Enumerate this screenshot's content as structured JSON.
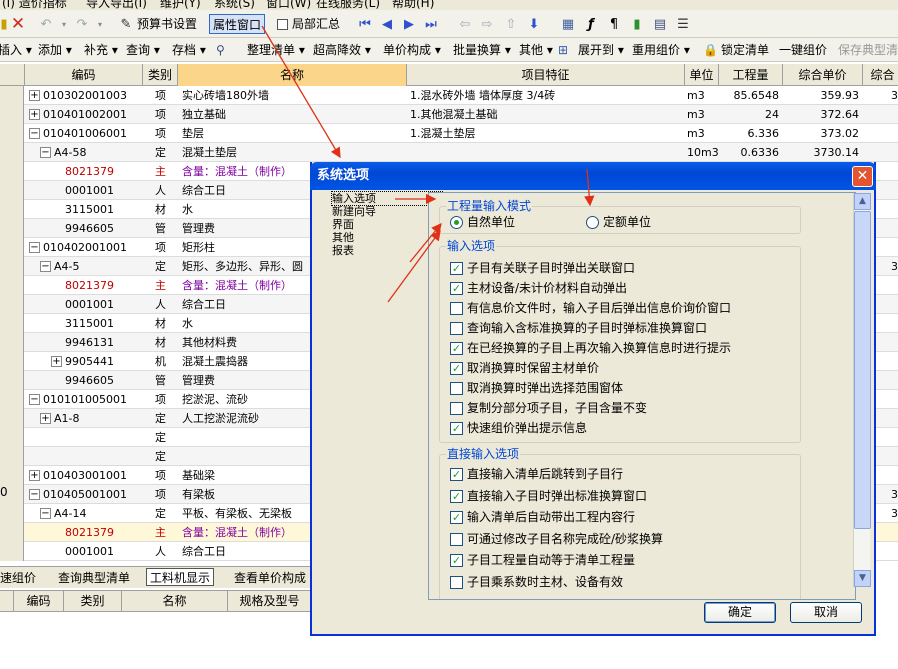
{
  "menu": [
    "(I)  造价指标",
    "导入导出(I)",
    "维护(Y)",
    "系统(S)",
    "窗口(W)",
    "在线服务(L)",
    "帮助(H)"
  ],
  "toolbar1": {
    "budget_settings": "预算书设置",
    "property_window": "属性窗口",
    "partial_summary": "局部汇总"
  },
  "toolbar2": {
    "insert": "插入",
    "add": "添加",
    "supplement": "补充",
    "query": "查询",
    "storage": "存档",
    "organize_list": "整理清单",
    "hyper_height": "超高降效",
    "unit_price_composition": "单价构成",
    "batch_convert": "批量换算",
    "other": "其他",
    "expand_to": "展开到",
    "reuse_composition": "重用组价",
    "lock_list": "锁定清单",
    "one_key_pricing": "一键组价",
    "save_typical": "保存典型清"
  },
  "grid": {
    "headers": [
      "编码",
      "类别",
      "名称",
      "项目特征",
      "单位",
      "工程量",
      "综合单价",
      "综合"
    ],
    "rows": [
      {
        "code": "010302001003",
        "cat": "项",
        "name": "实心砖墙180外墙",
        "feature": "1.混水砖外墙 墙体厚度 3/4砖",
        "unit": "m3",
        "qty": "85.6548",
        "price": "359.93",
        "extra": "3",
        "exp": "+",
        "indent": 1
      },
      {
        "code": "010401002001",
        "cat": "项",
        "name": "独立基础",
        "feature": "1.其他混凝土基础",
        "unit": "m3",
        "qty": "24",
        "price": "372.64",
        "extra": "",
        "exp": "+",
        "indent": 1
      },
      {
        "code": "010401006001",
        "cat": "项",
        "name": "垫层",
        "feature": "1.混凝土垫层",
        "unit": "m3",
        "qty": "6.336",
        "price": "373.02",
        "extra": "",
        "exp": "−",
        "indent": 1
      },
      {
        "code": "A4-58",
        "cat": "定",
        "name": "混凝土垫层",
        "feature": "",
        "unit": "10m3",
        "qty": "0.6336",
        "price": "3730.14",
        "extra": "",
        "exp": "−",
        "indent": 2
      },
      {
        "code": "8021379",
        "cat": "主",
        "name": "含量：混凝土（制作）",
        "feature": "",
        "unit": "",
        "qty": "",
        "price": "",
        "extra": "",
        "exp": "",
        "indent": 3,
        "red": true
      },
      {
        "code": "0001001",
        "cat": "人",
        "name": "综合工日",
        "feature": "",
        "unit": "",
        "qty": "",
        "price": "",
        "extra": "",
        "exp": "",
        "indent": 3
      },
      {
        "code": "3115001",
        "cat": "材",
        "name": "水",
        "feature": "",
        "unit": "",
        "qty": "",
        "price": "",
        "extra": "",
        "exp": "",
        "indent": 3
      },
      {
        "code": "9946605",
        "cat": "管",
        "name": "管理费",
        "feature": "",
        "unit": "",
        "qty": "",
        "price": "",
        "extra": "",
        "exp": "",
        "indent": 3
      },
      {
        "code": "010402001001",
        "cat": "项",
        "name": "矩形柱",
        "feature": "",
        "unit": "",
        "qty": "",
        "price": "",
        "extra": "",
        "exp": "−",
        "indent": 1
      },
      {
        "code": "A4-5",
        "cat": "定",
        "name": "矩形、多边形、异形、圆",
        "feature": "",
        "unit": "",
        "qty": "",
        "price": "",
        "extra": "3",
        "exp": "−",
        "indent": 2
      },
      {
        "code": "8021379",
        "cat": "主",
        "name": "含量：混凝土（制作）",
        "feature": "",
        "unit": "",
        "qty": "",
        "price": "",
        "extra": "",
        "exp": "",
        "indent": 3,
        "red": true
      },
      {
        "code": "0001001",
        "cat": "人",
        "name": "综合工日",
        "feature": "",
        "unit": "",
        "qty": "",
        "price": "",
        "extra": "",
        "exp": "",
        "indent": 3
      },
      {
        "code": "3115001",
        "cat": "材",
        "name": "水",
        "feature": "",
        "unit": "",
        "qty": "",
        "price": "",
        "extra": "",
        "exp": "",
        "indent": 3
      },
      {
        "code": "9946131",
        "cat": "材",
        "name": "其他材料费",
        "feature": "",
        "unit": "",
        "qty": "",
        "price": "",
        "extra": "",
        "exp": "",
        "indent": 3
      },
      {
        "code": "9905441",
        "cat": "机",
        "name": "混凝土震捣器",
        "feature": "",
        "unit": "",
        "qty": "",
        "price": "",
        "extra": "",
        "exp": "+",
        "indent": 3
      },
      {
        "code": "9946605",
        "cat": "管",
        "name": "管理费",
        "feature": "",
        "unit": "",
        "qty": "",
        "price": "",
        "extra": "",
        "exp": "",
        "indent": 3
      },
      {
        "code": "010101005001",
        "cat": "项",
        "name": "挖淤泥、流砂",
        "feature": "",
        "unit": "",
        "qty": "",
        "price": "",
        "extra": "",
        "exp": "−",
        "indent": 1
      },
      {
        "code": "A1-8",
        "cat": "定",
        "name": "人工挖淤泥流砂",
        "feature": "",
        "unit": "",
        "qty": "",
        "price": "",
        "extra": "",
        "exp": "+",
        "indent": 2
      },
      {
        "code": "",
        "cat": "定",
        "name": "",
        "feature": "",
        "unit": "",
        "qty": "",
        "price": "",
        "extra": "",
        "exp": "",
        "indent": 2
      },
      {
        "code": "",
        "cat": "定",
        "name": "",
        "feature": "",
        "unit": "",
        "qty": "",
        "price": "",
        "extra": "",
        "exp": "",
        "indent": 2
      },
      {
        "code": "010403001001",
        "cat": "项",
        "name": "基础梁",
        "feature": "",
        "unit": "",
        "qty": "",
        "price": "",
        "extra": "",
        "exp": "+",
        "indent": 1
      },
      {
        "code": "010405001001",
        "cat": "项",
        "name": "有梁板",
        "feature": "",
        "unit": "",
        "qty": "",
        "price": "",
        "extra": "3",
        "exp": "−",
        "indent": 1,
        "rownum": "0"
      },
      {
        "code": "A4-14",
        "cat": "定",
        "name": "平板、有梁板、无梁板",
        "feature": "",
        "unit": "",
        "qty": "",
        "price": "",
        "extra": "3",
        "exp": "−",
        "indent": 2
      },
      {
        "code": "8021379",
        "cat": "主",
        "name": "含量：混凝土（制作）",
        "feature": "",
        "unit": "",
        "qty": "",
        "price": "",
        "extra": "",
        "exp": "",
        "indent": 3,
        "red": true,
        "hl": true
      },
      {
        "code": "0001001",
        "cat": "人",
        "name": "综合工日",
        "feature": "",
        "unit": "",
        "qty": "",
        "price": "",
        "extra": "",
        "exp": "",
        "indent": 3
      }
    ]
  },
  "bottom_tabs": [
    "速组价",
    "查询典型清单",
    "工料机显示",
    "查看单价构成"
  ],
  "lower_headers": [
    "编码",
    "类别",
    "名称",
    "规格及型号"
  ],
  "dialog": {
    "title": "系统选项",
    "nav": [
      "输入选项",
      "新建向导",
      "界面",
      "其他",
      "报表"
    ],
    "mode_group": {
      "title": "工程量输入模式",
      "natural_unit": "自然单位",
      "quota_unit": "定额单位"
    },
    "input_group": {
      "title": "输入选项",
      "options": [
        {
          "label": "子目有关联子目时弹出关联窗口",
          "checked": true
        },
        {
          "label": "主材设备/未计价材料自动弹出",
          "checked": true
        },
        {
          "label": "有信息价文件时，输入子目后弹出信息价询价窗口",
          "checked": false
        },
        {
          "label": "查询输入含标准换算的子目时弹标准换算窗口",
          "checked": false
        },
        {
          "label": "在已经换算的子目上再次输入换算信息时进行提示",
          "checked": true
        },
        {
          "label": "取消换算时保留主材单价",
          "checked": true
        },
        {
          "label": "取消换算时弹出选择范围窗体",
          "checked": false
        },
        {
          "label": "复制分部分项子目，子目含量不变",
          "checked": false
        },
        {
          "label": "快速组价弹出提示信息",
          "checked": true
        }
      ]
    },
    "direct_group": {
      "title": "直接输入选项",
      "options": [
        {
          "label": "直接输入清单后跳转到子目行",
          "checked": true
        },
        {
          "label": "直接输入子目时弹出标准换算窗口",
          "checked": true
        },
        {
          "label": "输入清单后自动带出工程内容行",
          "checked": true
        },
        {
          "label": "可通过修改子目名称完成砼/砂浆换算",
          "checked": false
        },
        {
          "label": "子目工程量自动等于清单工程量",
          "checked": true
        },
        {
          "label": "子目乘系数时主材、设备有效",
          "checked": false
        }
      ]
    },
    "ok": "确定",
    "cancel": "取消"
  },
  "colors": {
    "accent_red": "#e03018",
    "title_blue": "#0047d5",
    "group_blue": "#0046d5",
    "check_green": "#21a121",
    "highlight_header": "#fbd58a",
    "code_red": "#c00000",
    "name_purple": "#8000a0"
  }
}
